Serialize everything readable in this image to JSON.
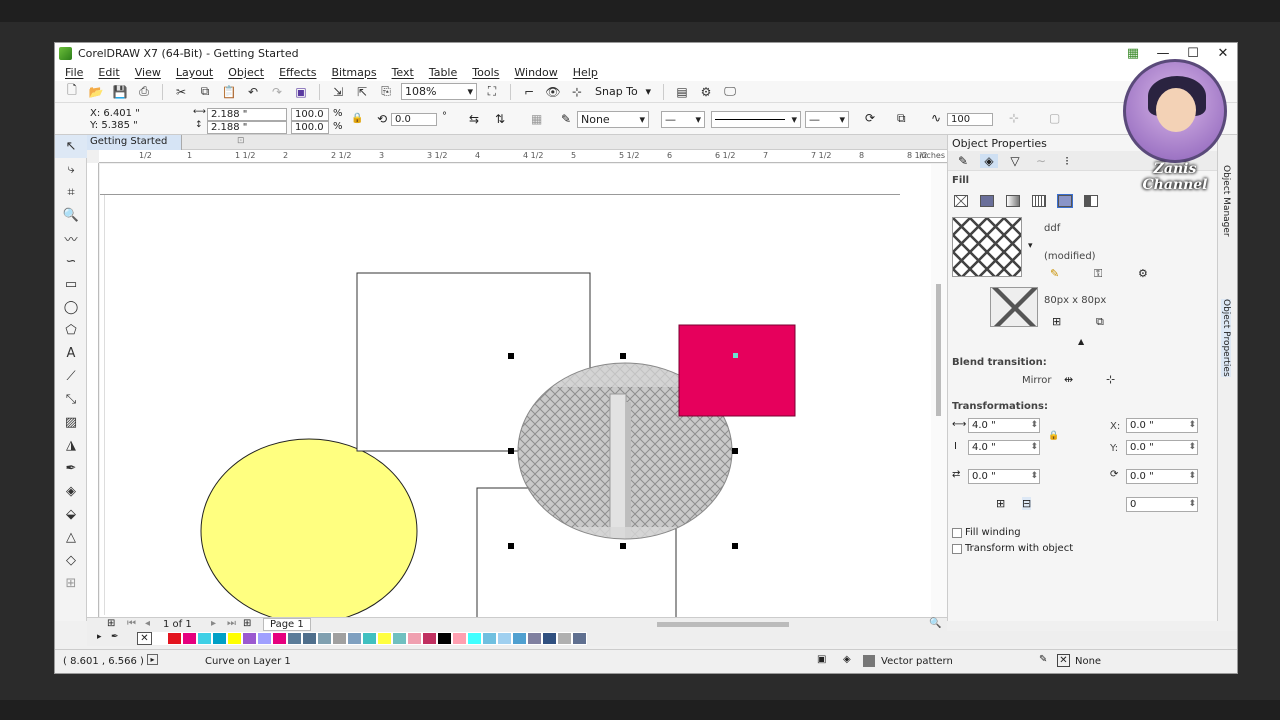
{
  "window": {
    "title": "CorelDRAW X7 (64-Bit) - Getting Started"
  },
  "menu": [
    "File",
    "Edit",
    "View",
    "Layout",
    "Object",
    "Effects",
    "Bitmaps",
    "Text",
    "Table",
    "Tools",
    "Window",
    "Help"
  ],
  "toolbar": {
    "zoom": "108%",
    "snap": "Snap To"
  },
  "propbar": {
    "x": "X: 6.401 \"",
    "y": "Y: 5.385 \"",
    "w": "2.188 \"",
    "h": "2.188 \"",
    "sx": "100.0",
    "sy": "100.0",
    "pct": "%",
    "angle": "0.0",
    "deg": "°",
    "outline": "None",
    "outline_width": "100"
  },
  "document": {
    "tab": "Getting Started",
    "ruler_units": "inches",
    "ruler_labels": [
      "1/2",
      "1",
      "1 1/2",
      "2",
      "2 1/2",
      "3",
      "3 1/2",
      "4",
      "4 1/2",
      "5",
      "5 1/2",
      "6",
      "6 1/2",
      "7",
      "7 1/2",
      "8",
      "8 1/2"
    ]
  },
  "pagebar": {
    "count": "1 of 1",
    "page": "Page 1"
  },
  "palette": [
    "#ffffff",
    "#e3141e",
    "#e6007e",
    "#3fd0e6",
    "#00a0c6",
    "#ffff00",
    "#9b59d0",
    "#a0a0ff",
    "#e6007e",
    "#5b7c99",
    "#4f6f8c",
    "#80a0b0",
    "#a0a0a0",
    "#7fa0c0",
    "#40c0c0",
    "#ffff40",
    "#70c0c0",
    "#f0a0b0",
    "#c03060",
    "#000000",
    "#ff9fb0",
    "#40ffff",
    "#70c0e0",
    "#a0d0f0",
    "#50a0d0",
    "#8080a0",
    "#305080",
    "#b0b0b0",
    "#607090"
  ],
  "status": {
    "coords": "( 8.601 , 6.566 )",
    "object": "Curve on Layer 1",
    "fill": "Vector pattern",
    "outline": "None"
  },
  "panel": {
    "title": "Object Properties",
    "section_fill": "Fill",
    "pattern_name": "ddf",
    "pattern_state": "(modified)",
    "pattern_size": "80px x 80px",
    "blend_header": "Blend transition:",
    "mirror": "Mirror",
    "transform_header": "Transformations:",
    "w": "4.0 \"",
    "h": "4.0 \"",
    "x": "X:",
    "xval": "0.0 \"",
    "y": "Y:",
    "yval": "0.0 \"",
    "rot": "0.0 \"",
    "skew": "0.0 \"",
    "extra": "0",
    "chk_winding": "Fill winding",
    "chk_transform": "Transform with object"
  },
  "side_tabs": {
    "manager": "Object Manager",
    "props": "Object Properties"
  },
  "channel": {
    "name": "Zanis Channel"
  }
}
